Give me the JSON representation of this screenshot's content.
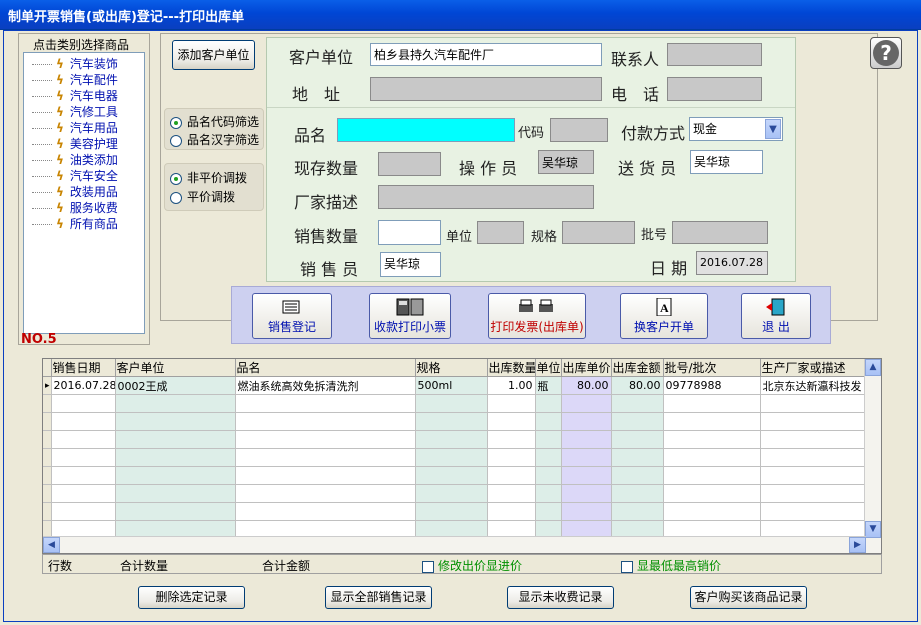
{
  "window": {
    "title": "制单开票销售(或出库)登记---打印出库单"
  },
  "category": {
    "header": "点击类别选择商品",
    "items": [
      "汽车装饰",
      "汽车配件",
      "汽车电器",
      "汽修工具",
      "汽车用品",
      "美容护理",
      "油类添加",
      "汽车安全",
      "改装用品",
      "服务收费",
      "所有商品"
    ],
    "no_label": "NO.5"
  },
  "customer": {
    "add_button": "添加客户单位",
    "unit_label": "客户单位",
    "unit_value": "柏乡县持久汽车配件厂",
    "contact_label": "联系人",
    "contact_value": "",
    "address_label": "地　址",
    "address_value": "",
    "phone_label": "电　话",
    "phone_value": ""
  },
  "filters": {
    "radio1": "品名代码筛选",
    "radio2": "品名汉字筛选",
    "radio3": "非平价调拨",
    "radio4": "平价调拨"
  },
  "product": {
    "name_label": "品名",
    "name_value": "",
    "code_label": "代码",
    "code_value": "",
    "payment_label": "付款方式",
    "payment_value": "现金",
    "stock_label": "现存数量",
    "stock_value": "",
    "operator_label": "操 作 员",
    "operator_value": "吴华琼",
    "delivery_label": "送 货 员",
    "delivery_value": "吴华琼",
    "maker_label": "厂家描述",
    "maker_value": "",
    "qty_label": "销售数量",
    "qty_value": "",
    "unit_label": "单位",
    "unit_value": "",
    "spec_label": "规格",
    "spec_value": "",
    "batch_label": "批号",
    "batch_value": "",
    "seller_label": "销 售 员",
    "seller_value": "吴华琼",
    "date_label": "日 期",
    "date_value": "2016.07.28"
  },
  "toolbar": {
    "register": "销售登记",
    "receipt": "收款打印小票",
    "invoice": "打印发票(出库单)",
    "switch": "换客户开单",
    "exit": "退 出"
  },
  "table": {
    "headers": [
      "销售日期",
      "客户单位",
      "品名",
      "规格",
      "出库数量",
      "单位",
      "出库单价",
      "出库金额",
      "批号/批次",
      "生产厂家或描述"
    ],
    "rows": [
      [
        "2016.07.28",
        "0002王成",
        "燃油系统高效免拆清洗剂",
        "500ml",
        "1.00",
        "瓶",
        "80.00",
        "80.00",
        "09778988",
        "北京东达新瀛科技发"
      ]
    ]
  },
  "footer": {
    "row_count": "行数",
    "total_qty": "合计数量",
    "total_amount": "合计金额",
    "check1": "修改出价显进价",
    "check2": "显最低最高销价"
  },
  "actions": {
    "delete": "删除选定记录",
    "show_all": "显示全部销售记录",
    "show_unpaid": "显示未收费记录",
    "customer_history": "客户购买该商品记录"
  },
  "colors": {
    "titlebar": "#0054e3",
    "panel_green": "#e8f2e3",
    "cyan": "#00ffff"
  }
}
